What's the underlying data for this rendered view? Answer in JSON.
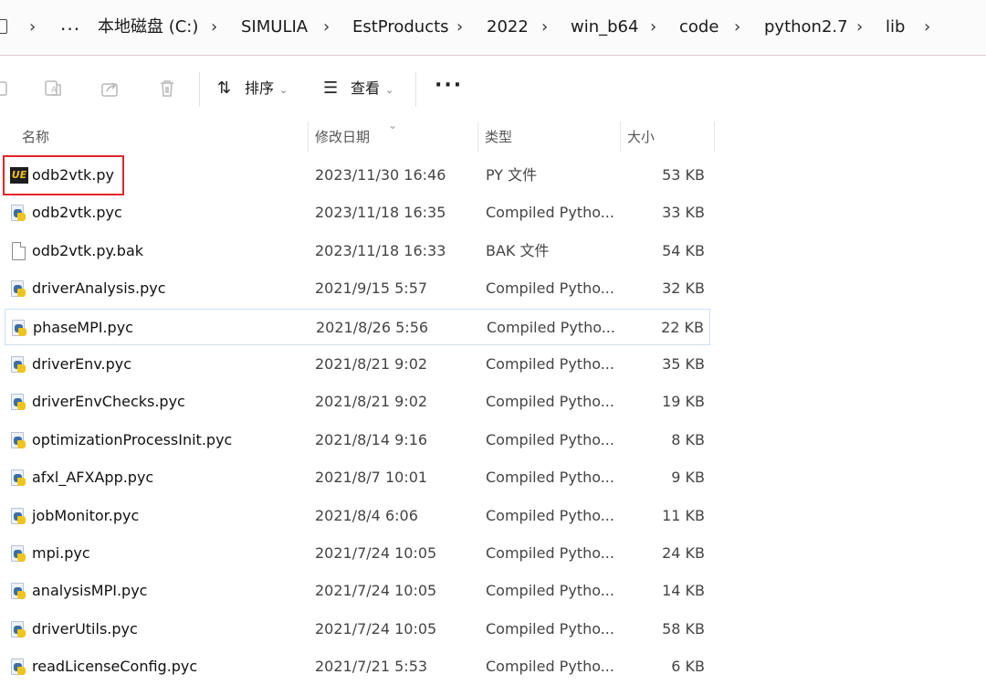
{
  "breadcrumb": {
    "items": [
      "本地磁盘 (C:)",
      "SIMULIA",
      "EstProducts",
      "2022",
      "win_b64",
      "code",
      "python2.7",
      "lib"
    ],
    "overflow": "..."
  },
  "toolbar": {
    "sort_label": "排序",
    "view_label": "查看",
    "more": "···",
    "icons": [
      "copy-icon",
      "rename-icon",
      "share-icon",
      "delete-icon"
    ]
  },
  "columns": {
    "name": "名称",
    "date": "修改日期",
    "type": "类型",
    "size": "大小"
  },
  "files": [
    {
      "name": "odb2vtk.py",
      "date": "2023/11/30 16:46",
      "type": "PY 文件",
      "size": "53 KB",
      "icon": "ue-icon"
    },
    {
      "name": "odb2vtk.pyc",
      "date": "2023/11/18 16:35",
      "type": "Compiled Pytho...",
      "size": "33 KB",
      "icon": "python-icon"
    },
    {
      "name": "odb2vtk.py.bak",
      "date": "2023/11/18 16:33",
      "type": "BAK 文件",
      "size": "54 KB",
      "icon": "file-icon"
    },
    {
      "name": "driverAnalysis.pyc",
      "date": "2021/9/15 5:57",
      "type": "Compiled Pytho...",
      "size": "32 KB",
      "icon": "python-icon"
    },
    {
      "name": "phaseMPI.pyc",
      "date": "2021/8/26 5:56",
      "type": "Compiled Pytho...",
      "size": "22 KB",
      "icon": "python-icon"
    },
    {
      "name": "driverEnv.pyc",
      "date": "2021/8/21 9:02",
      "type": "Compiled Pytho...",
      "size": "35 KB",
      "icon": "python-icon"
    },
    {
      "name": "driverEnvChecks.pyc",
      "date": "2021/8/21 9:02",
      "type": "Compiled Pytho...",
      "size": "19 KB",
      "icon": "python-icon"
    },
    {
      "name": "optimizationProcessInit.pyc",
      "date": "2021/8/14 9:16",
      "type": "Compiled Pytho...",
      "size": "8 KB",
      "icon": "python-icon"
    },
    {
      "name": "afxl_AFXApp.pyc",
      "date": "2021/8/7 10:01",
      "type": "Compiled Pytho...",
      "size": "9 KB",
      "icon": "python-icon"
    },
    {
      "name": "jobMonitor.pyc",
      "date": "2021/8/4 6:06",
      "type": "Compiled Pytho...",
      "size": "11 KB",
      "icon": "python-icon"
    },
    {
      "name": "mpi.pyc",
      "date": "2021/7/24 10:05",
      "type": "Compiled Pytho...",
      "size": "24 KB",
      "icon": "python-icon"
    },
    {
      "name": "analysisMPI.pyc",
      "date": "2021/7/24 10:05",
      "type": "Compiled Pytho...",
      "size": "14 KB",
      "icon": "python-icon"
    },
    {
      "name": "driverUtils.pyc",
      "date": "2021/7/24 10:05",
      "type": "Compiled Pytho...",
      "size": "58 KB",
      "icon": "python-icon"
    },
    {
      "name": "readLicenseConfig.pyc",
      "date": "2021/7/21 5:53",
      "type": "Compiled Pytho...",
      "size": "6 KB",
      "icon": "python-icon"
    }
  ],
  "selected_row": "phaseMPI.pyc",
  "highlight_color": "#e0262b"
}
